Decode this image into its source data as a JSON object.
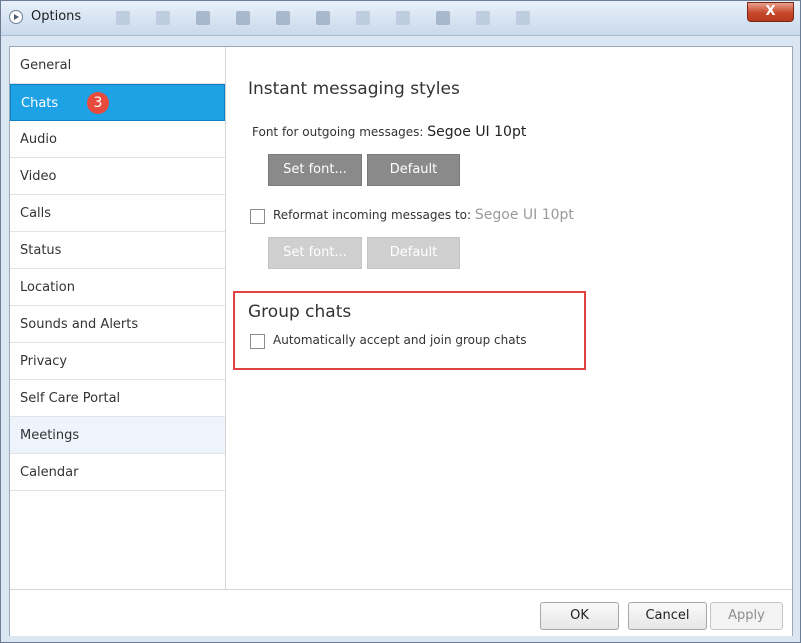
{
  "window": {
    "title": "Options",
    "close_label": "X"
  },
  "sidebar": {
    "items": [
      {
        "label": "General"
      },
      {
        "label": "Chats",
        "badge": "3"
      },
      {
        "label": "Audio"
      },
      {
        "label": "Video"
      },
      {
        "label": "Calls"
      },
      {
        "label": "Status"
      },
      {
        "label": "Location"
      },
      {
        "label": "Sounds and Alerts"
      },
      {
        "label": "Privacy"
      },
      {
        "label": "Self Care Portal"
      },
      {
        "label": "Meetings"
      },
      {
        "label": "Calendar"
      }
    ]
  },
  "content": {
    "im_styles": {
      "title": "Instant messaging styles",
      "outgoing_label": "Font for outgoing messages:",
      "outgoing_value": "Segoe UI 10pt",
      "set_font_label": "Set font...",
      "default_label": "Default",
      "reformat_label": "Reformat incoming messages to:",
      "reformat_value": "Segoe UI 10pt",
      "reformat_set_font_label": "Set font...",
      "reformat_default_label": "Default"
    },
    "group_chats": {
      "title": "Group chats",
      "auto_accept_label": "Automatically accept and join group chats"
    }
  },
  "footer": {
    "ok_label": "OK",
    "cancel_label": "Cancel",
    "apply_label": "Apply"
  },
  "colors": {
    "selected": "#1ea2e6",
    "badge": "#e84a3c",
    "highlight_box": "#e14343"
  }
}
